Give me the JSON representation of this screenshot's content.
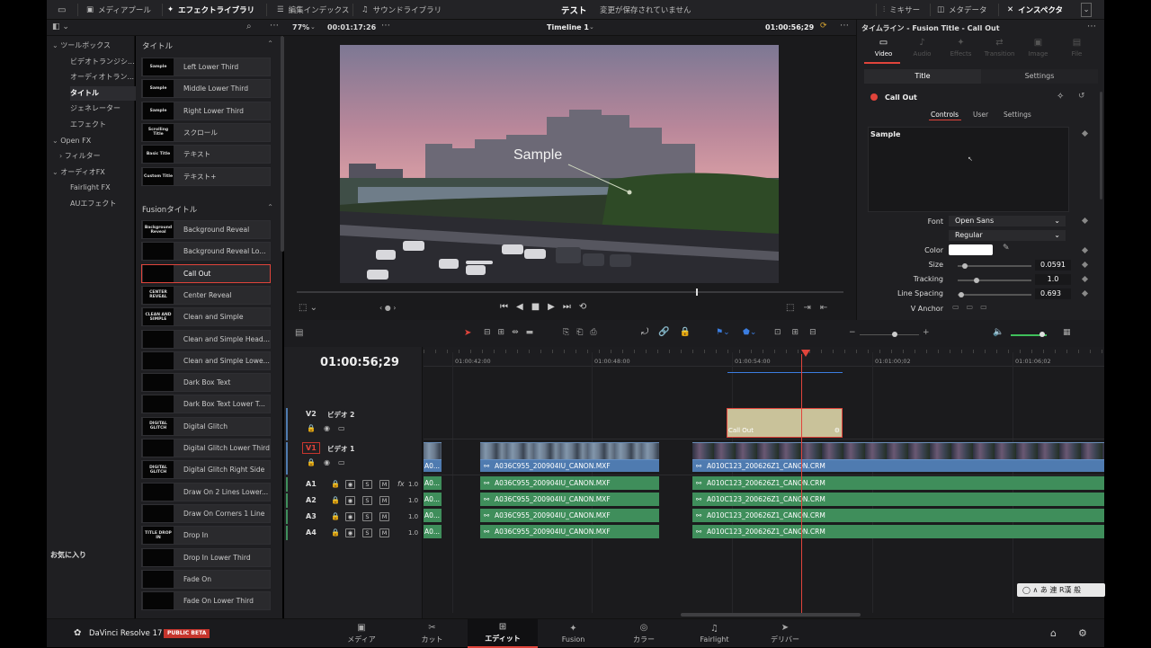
{
  "topbar": {
    "media_pool": "メディアプール",
    "effects_library": "エフェクトライブラリ",
    "edit_index": "編集インデックス",
    "sound_library": "サウンドライブラリ",
    "project_name": "テスト",
    "save_status": "変更が保存されていません",
    "mixer": "ミキサー",
    "metadata": "メタデータ",
    "inspector": "インスペクタ"
  },
  "viewer_bar": {
    "zoom": "77%",
    "source_timecode": "00:01:17:26",
    "timeline_name": "Timeline 1",
    "timeline_timecode": "01:00:56;29"
  },
  "effects_tree": {
    "items": [
      {
        "label": "ツールボックス",
        "indent": 1,
        "expanded": true
      },
      {
        "label": "ビデオトランジシ...",
        "indent": 2
      },
      {
        "label": "オーディオトラン...",
        "indent": 2
      },
      {
        "label": "タイトル",
        "indent": 2,
        "selected": true
      },
      {
        "label": "ジェネレーター",
        "indent": 2
      },
      {
        "label": "エフェクト",
        "indent": 2
      },
      {
        "label": "Open FX",
        "indent": 1,
        "expanded": true
      },
      {
        "label": "フィルター",
        "indent": 2,
        "collapsed": true
      },
      {
        "label": "オーディオFX",
        "indent": 1,
        "expanded": true
      },
      {
        "label": "Fairlight FX",
        "indent": 2
      },
      {
        "label": "AUエフェクト",
        "indent": 2
      }
    ],
    "favorites": "お気に入り"
  },
  "titles_section": {
    "heading": "タイトル",
    "items": [
      {
        "label": "Left Lower Third",
        "thumb": "Sample"
      },
      {
        "label": "Middle Lower Third",
        "thumb": "Sample"
      },
      {
        "label": "Right Lower Third",
        "thumb": "Sample"
      },
      {
        "label": "スクロール",
        "thumb": "Scrolling Title"
      },
      {
        "label": "テキスト",
        "thumb": "Basic Title"
      },
      {
        "label": "テキスト+",
        "thumb": "Custom Title"
      }
    ]
  },
  "fusion_section": {
    "heading": "Fusionタイトル",
    "selected_index": 2,
    "items": [
      {
        "label": "Background Reveal",
        "thumb": "Background Reveal"
      },
      {
        "label": "Background Reveal Lo...",
        "thumb": ""
      },
      {
        "label": "Call Out",
        "thumb": ""
      },
      {
        "label": "Center Reveal",
        "thumb": "CENTER REVEAL"
      },
      {
        "label": "Clean and Simple",
        "thumb": "CLEAN AND SIMPLE"
      },
      {
        "label": "Clean and Simple Head...",
        "thumb": ""
      },
      {
        "label": "Clean and Simple Lowe...",
        "thumb": ""
      },
      {
        "label": "Dark Box Text",
        "thumb": ""
      },
      {
        "label": "Dark Box Text Lower T...",
        "thumb": ""
      },
      {
        "label": "Digital Glitch",
        "thumb": "DIGITAL GLITCH"
      },
      {
        "label": "Digital Glitch Lower Third",
        "thumb": ""
      },
      {
        "label": "Digital Glitch Right Side",
        "thumb": "DIGITAL GLITCH"
      },
      {
        "label": "Draw On 2 Lines Lower...",
        "thumb": ""
      },
      {
        "label": "Draw On Corners 1 Line",
        "thumb": ""
      },
      {
        "label": "Drop In",
        "thumb": "TITLE DROP IN"
      },
      {
        "label": "Drop In Lower Third",
        "thumb": ""
      },
      {
        "label": "Fade On",
        "thumb": ""
      },
      {
        "label": "Fade On Lower Third",
        "thumb": ""
      }
    ]
  },
  "viewer": {
    "overlay_text": "Sample"
  },
  "inspector": {
    "header": "タイムライン - Fusion Title - Call Out",
    "tabs": [
      "Video",
      "Audio",
      "Effects",
      "Transition",
      "Image",
      "File"
    ],
    "active_tab": "Video",
    "subtabs": [
      "Title",
      "Settings"
    ],
    "effect_name": "Call Out",
    "ctrl_tabs": [
      "Controls",
      "User",
      "Settings"
    ],
    "sample_text": "Sample",
    "font_label": "Font",
    "font_value": "Open Sans",
    "font_style": "Regular",
    "color_label": "Color",
    "size_label": "Size",
    "size_value": "0.0591",
    "size_fraction": 0.1,
    "tracking_label": "Tracking",
    "tracking_value": "1.0",
    "tracking_fraction": 0.25,
    "line_spacing_label": "Line Spacing",
    "line_spacing_value": "0.693",
    "line_spacing_fraction": 0.05,
    "v_anchor_label": "V Anchor",
    "text_color": "#ffffff"
  },
  "timeline": {
    "timecode": "01:00:56;29",
    "ruler": [
      "01:00:42:00",
      "01:00:48:00",
      "01:00:54:00",
      "01:01:00;02",
      "01:01:06;02"
    ],
    "tracks": [
      {
        "id": "V2",
        "name": "ビデオ 2"
      },
      {
        "id": "V1",
        "name": "ビデオ 1"
      },
      {
        "id": "A1",
        "vol": "1.0"
      },
      {
        "id": "A2",
        "vol": "1.0"
      },
      {
        "id": "A3",
        "vol": "1.0"
      },
      {
        "id": "A4",
        "vol": "1.0"
      }
    ],
    "title_clip": "Call Out",
    "clip_a": "A036C955_200904IU_CANON.MXF",
    "clip_b": "A010C123_200626Z1_CANON.CRM",
    "clip_edge": "A0...",
    "fx_label": "fx",
    "s_label": "S",
    "m_label": "M"
  },
  "ime": {
    "text": "あ 連 R漢 般"
  },
  "bottom": {
    "app_name": "DaVinci Resolve 17",
    "badge": "PUBLIC BETA",
    "pages": [
      "メディア",
      "カット",
      "エディット",
      "Fusion",
      "カラー",
      "Fairlight",
      "デリバー"
    ],
    "active_page": "エディット"
  },
  "colors": {
    "accent_red": "#e0443b",
    "clip_blue": "#4f7bb0",
    "clip_green": "#3f8e5b",
    "title_clip": "#c9c29a"
  }
}
